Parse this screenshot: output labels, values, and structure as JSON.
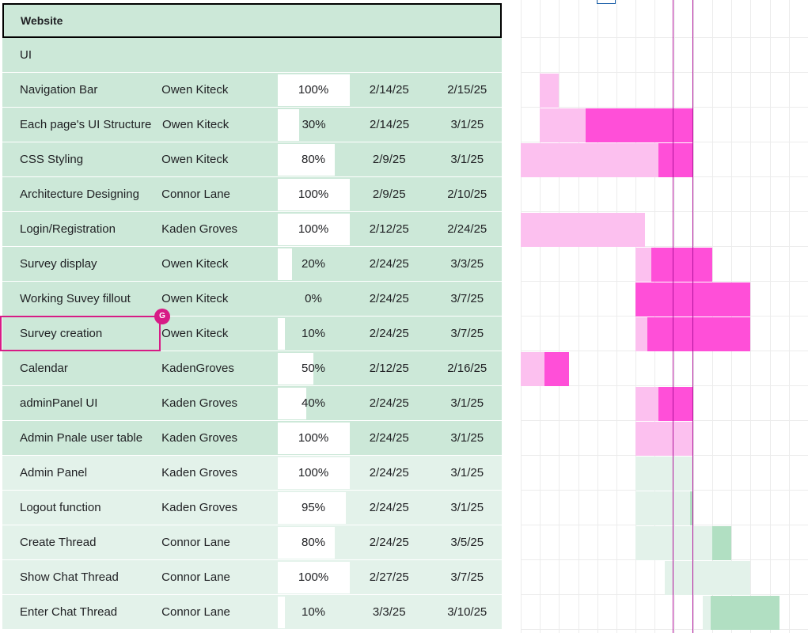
{
  "group": {
    "title": "Website"
  },
  "tasks": [
    {
      "name": "UI",
      "owner": "",
      "progress": "",
      "start": "",
      "end": "",
      "pct": 0,
      "shade": "dark"
    },
    {
      "name": "Navigation Bar",
      "owner": "Owen Kiteck",
      "progress": "100%",
      "start": "2/14/25",
      "end": "2/15/25",
      "pct": 100,
      "shade": "dark"
    },
    {
      "name": "Each page's UI Structure",
      "owner": "Owen Kiteck",
      "progress": "30%",
      "start": "2/14/25",
      "end": "3/1/25",
      "pct": 30,
      "shade": "dark"
    },
    {
      "name": "CSS Styling",
      "owner": "Owen Kiteck",
      "progress": "80%",
      "start": "2/9/25",
      "end": "3/1/25",
      "pct": 80,
      "shade": "dark"
    },
    {
      "name": "Architecture Designing",
      "owner": "Connor Lane",
      "progress": "100%",
      "start": "2/9/25",
      "end": "2/10/25",
      "pct": 100,
      "shade": "dark"
    },
    {
      "name": "Login/Registration",
      "owner": "Kaden Groves",
      "progress": "100%",
      "start": "2/12/25",
      "end": "2/24/25",
      "pct": 100,
      "shade": "dark"
    },
    {
      "name": "Survey display",
      "owner": "Owen Kiteck",
      "progress": "20%",
      "start": "2/24/25",
      "end": "3/3/25",
      "pct": 20,
      "shade": "dark"
    },
    {
      "name": "Working Suvey fillout",
      "owner": "Owen Kiteck",
      "progress": "0%",
      "start": "2/24/25",
      "end": "3/7/25",
      "pct": 0,
      "shade": "dark"
    },
    {
      "name": "Survey creation",
      "owner": "Owen Kiteck",
      "progress": "10%",
      "start": "2/24/25",
      "end": "3/7/25",
      "pct": 10,
      "shade": "dark"
    },
    {
      "name": "Calendar",
      "owner": "KadenGroves",
      "progress": "50%",
      "start": "2/12/25",
      "end": "2/16/25",
      "pct": 50,
      "shade": "dark"
    },
    {
      "name": "adminPanel UI",
      "owner": "Kaden Groves",
      "progress": "40%",
      "start": "2/24/25",
      "end": "3/1/25",
      "pct": 40,
      "shade": "dark"
    },
    {
      "name": "Admin Pnale user table",
      "owner": "Kaden Groves",
      "progress": "100%",
      "start": "2/24/25",
      "end": "3/1/25",
      "pct": 100,
      "shade": "dark"
    },
    {
      "name": "Admin Panel",
      "owner": "Kaden Groves",
      "progress": "100%",
      "start": "2/24/25",
      "end": "3/1/25",
      "pct": 100,
      "shade": "light"
    },
    {
      "name": "Logout function",
      "owner": "Kaden Groves",
      "progress": "95%",
      "start": "2/24/25",
      "end": "3/1/25",
      "pct": 95,
      "shade": "light"
    },
    {
      "name": "Create Thread",
      "owner": "Connor Lane",
      "progress": "80%",
      "start": "2/24/25",
      "end": "3/5/25",
      "pct": 80,
      "shade": "light"
    },
    {
      "name": "Show Chat Thread",
      "owner": "Connor Lane",
      "progress": "100%",
      "start": "2/27/25",
      "end": "3/7/25",
      "pct": 100,
      "shade": "light"
    },
    {
      "name": "Enter Chat Thread",
      "owner": "Connor Lane",
      "progress": "10%",
      "start": "3/3/25",
      "end": "3/10/25",
      "pct": 10,
      "shade": "light"
    }
  ],
  "selection": {
    "badge": "G"
  },
  "colors": {
    "group_bg": "#cce8d8",
    "row_dark": "#cce8d8",
    "row_light": "#e3f2ea",
    "bar_done_pink": "#fcc0ef",
    "bar_remaining_pink": "#ff4fd8",
    "bar_done_green": "#e3f2ea",
    "bar_remaining_green": "#b1dfc2",
    "today_line": "#b0149b",
    "selection": "#d71b86"
  }
}
